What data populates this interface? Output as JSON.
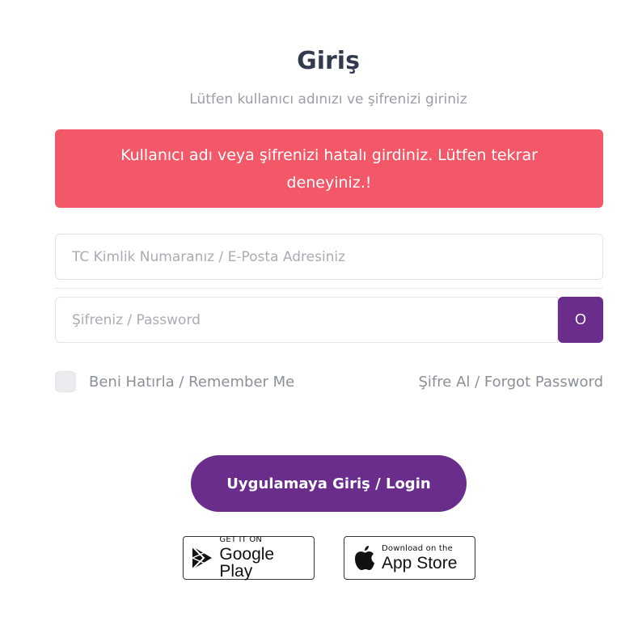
{
  "header": {
    "title": "Giriş",
    "subtitle": "Lütfen kullanıcı adınızı ve şifrenizi giriniz"
  },
  "alert": {
    "message": "Kullanıcı adı veya şifrenizi hatalı girdiniz. Lütfen tekrar deneyiniz.!",
    "color": "#f35868"
  },
  "form": {
    "username_placeholder": "TC Kimlik Numaranız / E-Posta Adresiniz",
    "username_value": "",
    "password_placeholder": "Şifreniz / Password",
    "password_value": "",
    "show_password_label": "O",
    "remember_label": "Beni Hatırla / Remember Me",
    "remember_checked": false,
    "forgot_label": "Şifre Al / Forgot Password",
    "submit_label": "Uygulamaya Giriş / Login"
  },
  "stores": {
    "google_small": "GET IT ON",
    "google_big": "Google Play",
    "apple_small": "Download on the",
    "apple_big": "App Store"
  },
  "colors": {
    "accent": "#6a2d8c",
    "error": "#f35868"
  },
  "icons": {
    "google": "google-play-icon",
    "apple": "apple-icon"
  }
}
